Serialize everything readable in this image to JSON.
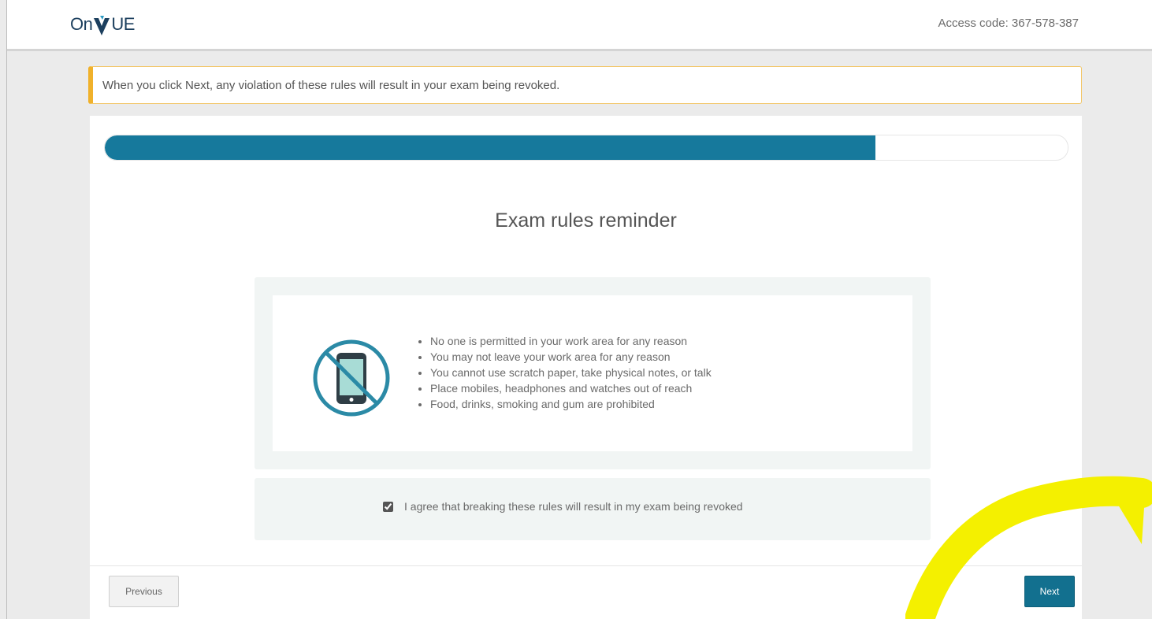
{
  "header": {
    "logo_text_prefix": "On",
    "logo_text_suffix": "UE",
    "access_code": "Access code: 367-578-387"
  },
  "warning": {
    "text": "When you click Next, any violation of these rules will result in your exam being revoked."
  },
  "progress": {
    "percent": 80
  },
  "main": {
    "title": "Exam rules reminder",
    "rules_icon": "no-phone-icon",
    "rules": [
      "No one is permitted in your work area for any reason",
      "You may not leave your work area for any reason",
      "You cannot use scratch paper, take physical notes, or talk",
      "Place mobiles, headphones and watches out of reach",
      "Food, drinks, smoking and gum are prohibited"
    ],
    "agreement": {
      "label": "I agree that breaking these rules will result in my exam being revoked",
      "checked": true
    }
  },
  "footer": {
    "previous_label": "Previous",
    "next_label": "Next"
  },
  "colors": {
    "brand": "#1c3f5e",
    "accent": "#16799c",
    "warning_border": "#f0b12b",
    "annotation": "#f4f000"
  }
}
